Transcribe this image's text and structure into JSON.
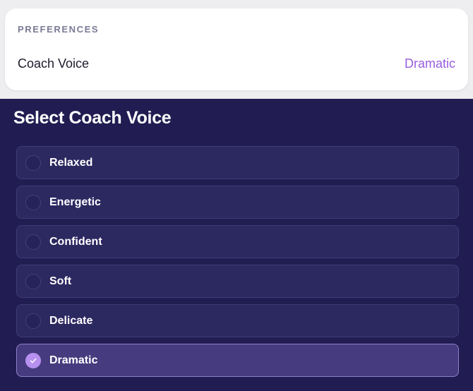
{
  "preferences": {
    "heading": "PREFERENCES",
    "coach_voice_label": "Coach Voice",
    "coach_voice_value": "Dramatic"
  },
  "sheet": {
    "title": "Select Coach Voice",
    "options": [
      {
        "label": "Relaxed",
        "selected": false
      },
      {
        "label": "Energetic",
        "selected": false
      },
      {
        "label": "Confident",
        "selected": false
      },
      {
        "label": "Soft",
        "selected": false
      },
      {
        "label": "Delicate",
        "selected": false
      },
      {
        "label": "Dramatic",
        "selected": true
      }
    ]
  },
  "colors": {
    "accent": "#9a5de0",
    "sheet_background": "#211d52",
    "selected_radio": "#b790f0"
  },
  "icons": {
    "selected_indicator": "check-icon"
  }
}
